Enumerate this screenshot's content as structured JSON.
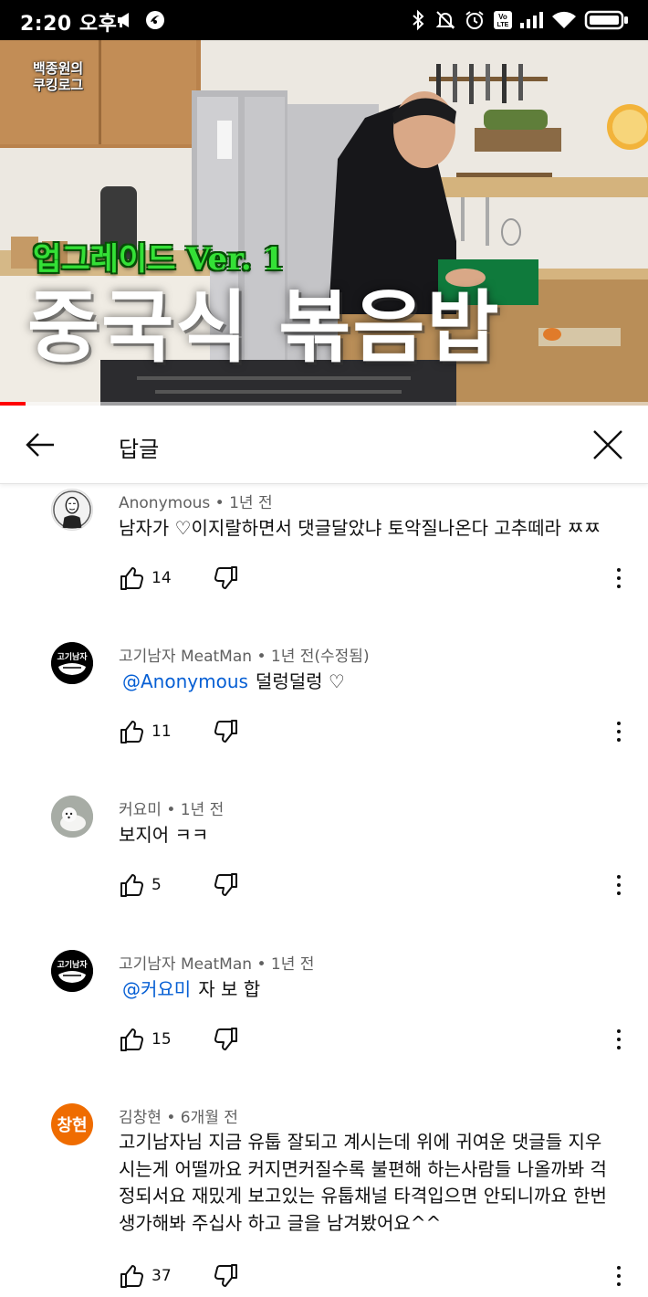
{
  "status_bar": {
    "time": "2:20 오후",
    "icons": [
      "megaphone-icon",
      "browser-icon",
      "bluetooth-icon",
      "mute-icon",
      "alarm-icon",
      "volte-icon",
      "signal-icon",
      "wifi-icon",
      "battery-icon"
    ]
  },
  "video": {
    "brand_line1": "백종원의",
    "brand_line2": "쿠킹로그",
    "subtitle": "업그레이드 Ver. 1",
    "title": "중국식 볶음밥",
    "progress_fraction": 0.04
  },
  "header": {
    "title": "답글",
    "back_icon": "arrow-left-icon",
    "close_icon": "close-icon"
  },
  "comments": [
    {
      "author": "Anonymous",
      "time": "1년 전",
      "edited": "",
      "avatar": "anonymous-mask",
      "mention": "",
      "text": "남자가 ♡이지랄하면서 댓글달았냐 토악질나온다 고추떼라 ㅉㅉ",
      "likes": "14"
    },
    {
      "author": "고기남자 MeatMan",
      "time": "1년 전",
      "edited": "(수정됨)",
      "avatar": "meatman-logo",
      "avatar_text": "고기남자",
      "mention": "@Anonymous",
      "text": "덜렁덜렁 ♡",
      "likes": "11"
    },
    {
      "author": "커요미",
      "time": "1년 전",
      "edited": "",
      "avatar": "dog-photo",
      "mention": "",
      "text": "보지어 ㅋㅋ",
      "likes": "5"
    },
    {
      "author": "고기남자 MeatMan",
      "time": "1년 전",
      "edited": "",
      "avatar": "meatman-logo",
      "avatar_text": "고기남자",
      "mention": "@커요미",
      "text": "자 보 합",
      "likes": "15"
    },
    {
      "author": "김창현",
      "time": "6개월 전",
      "edited": "",
      "avatar": "initials",
      "avatar_text": "창현",
      "mention": "",
      "text_lines": [
        "고기남자님 지금 유툽 잘되고 계시는데 위에 귀여운 댓글들 지우",
        "시는게 어떨까요 커지면커질수록 불편해 하는사람들 나올까봐 걱",
        "정되서요 재밌게 보고있는 유툽채널 타격입으면 안되니까요 한번",
        "생가해봐 주십사 하고 글을 남겨봤어요^^"
      ],
      "likes": "37"
    }
  ],
  "colors": {
    "mention": "#065fd4",
    "meta": "#606060",
    "progress": "#ff0000",
    "initials_avatar": "#ef6c00"
  }
}
